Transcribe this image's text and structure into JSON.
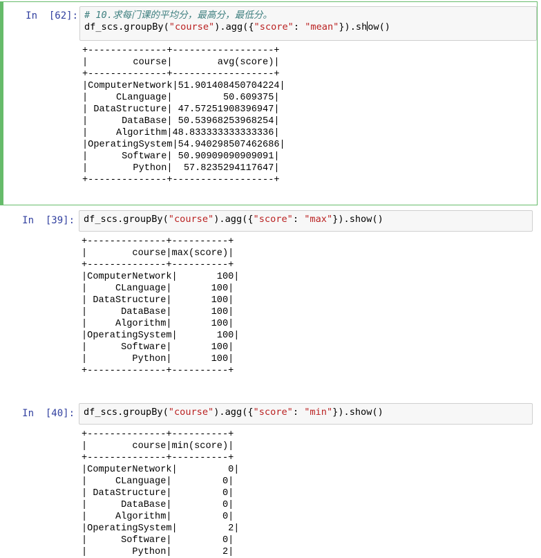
{
  "cells": [
    {
      "prompt": "In  [62]:",
      "comment": "# 10.求每门课的平均分，最高分，最低分。",
      "code_prefix": "df_scs.groupBy(",
      "code_arg": "\"course\"",
      "code_mid": ").agg({",
      "code_key": "\"score\"",
      "code_colon": ": ",
      "code_val": "\"mean\"",
      "code_suffix_a": "}).sh",
      "code_suffix_b": "ow()",
      "output": "+--------------+------------------+\n|        course|        avg(score)|\n+--------------+------------------+\n|ComputerNetwork|51.901408450704224|\n|     CLanguage|         50.609375|\n| DataStructure| 47.57251908396947|\n|      DataBase| 50.53968253968254|\n|     Algorithm|48.833333333333336|\n|OperatingSystem|54.940298507462686|\n|      Software| 50.90909090909091|\n|        Python|  57.8235294117647|\n+--------------+------------------+"
    },
    {
      "prompt": "In  [39]:",
      "code_prefix": "df_scs.groupBy(",
      "code_arg": "\"course\"",
      "code_mid": ").agg({",
      "code_key": "\"score\"",
      "code_colon": ": ",
      "code_val": "\"max\"",
      "code_suffix": "}).show()",
      "output": "+--------------+----------+\n|        course|max(score)|\n+--------------+----------+\n|ComputerNetwork|       100|\n|     CLanguage|       100|\n| DataStructure|       100|\n|      DataBase|       100|\n|     Algorithm|       100|\n|OperatingSystem|       100|\n|      Software|       100|\n|        Python|       100|\n+--------------+----------+"
    },
    {
      "prompt": "In  [40]:",
      "code_prefix": "df_scs.groupBy(",
      "code_arg": "\"course\"",
      "code_mid": ").agg({",
      "code_key": "\"score\"",
      "code_colon": ": ",
      "code_val": "\"min\"",
      "code_suffix": "}).show()",
      "output": "+--------------+----------+\n|        course|min(score)|\n+--------------+----------+\n|ComputerNetwork|         0|\n|     CLanguage|         0|\n| DataStructure|         0|\n|      DataBase|         0|\n|     Algorithm|         0|\n|OperatingSystem|         2|\n|      Software|         0|\n|        Python|         2|"
    }
  ]
}
